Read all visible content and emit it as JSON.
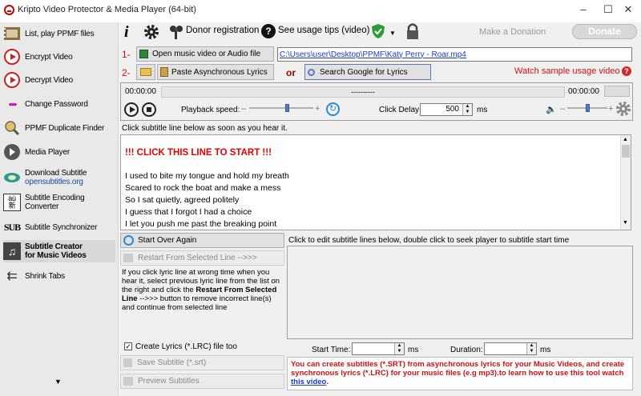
{
  "window": {
    "title": "Kripto Video Protector & Media Player (64-bit)",
    "controls": [
      "–",
      "☐",
      "✕"
    ]
  },
  "sidebar": {
    "items": [
      {
        "label": "List, play PPMF files",
        "icon": "film-list-icon"
      },
      {
        "label": "Encrypt Video",
        "icon": "encrypt-play-icon"
      },
      {
        "label": "Decrypt Video",
        "icon": "decrypt-play-icon"
      },
      {
        "label": "Change Password",
        "icon": "password-dots-icon"
      },
      {
        "label": "PPMF Duplicate Finder",
        "icon": "magnifier-icon"
      },
      {
        "label": "Media Player",
        "icon": "media-player-icon"
      },
      {
        "label": "Download Subtitle",
        "sub": "opensubtitles.org",
        "icon": "opensubtitles-icon"
      },
      {
        "label": "Subtitle Encoding",
        "sub": "Converter",
        "icon": "encoding-icon"
      },
      {
        "label": "Subtitle Synchronizer",
        "icon": "sub-sync-icon"
      },
      {
        "label": "Subtitle Creator",
        "sub": "for Music Videos",
        "icon": "music-subtitle-icon"
      },
      {
        "label": "Shrink Tabs",
        "icon": "shrink-arrows-icon"
      }
    ],
    "more_arrow": "▼"
  },
  "toolbar": {
    "donor_label": "Donor registration",
    "tips_label": "See usage tips (video)",
    "make_donation": "Make a Donation",
    "donate": "Donate"
  },
  "step1": {
    "number": "1-",
    "open_label": "Open music video or Audio file",
    "file_path": "C:\\Users\\user\\Desktop\\PPMF\\Katy Perry - Roar.mp4"
  },
  "step2": {
    "number": "2-",
    "paste_label": "Paste Asynchronous Lyrics",
    "or": "or",
    "search_label": "Search Google for Lyrics",
    "watch_label": "Watch sample usage video"
  },
  "player": {
    "time_start": "00:00:00",
    "time_mid": "----------",
    "time_end": "00:00:00",
    "speed_label": "Playback speed:",
    "minus": "–",
    "plus": "+",
    "delay_label": "Click Delay:",
    "delay_value": "500",
    "delay_unit": "ms",
    "speed_level": 0.6,
    "volume_level": 0.5
  },
  "instruction": "Click subtitle line below as soon as you hear it.",
  "lyrics": [
    "!!! CLICK THIS LINE TO START !!!",
    "I used to bite my tongue and hold my breath",
    "Scared to rock the boat and make a mess",
    "So I sat quietly, agreed politely",
    "I guess that I forgot I had a choice",
    "I let you push me past the breaking point"
  ],
  "controls": {
    "start_over": "Start Over Again",
    "restart_selected": "Restart From Selected Line -->>>",
    "help_text_1": "If you click lyric line at wrong time when you hear it, select previous lyric line from the list on the right and click the ",
    "help_text_bold": "Restart From Selected Line",
    "help_text_2": " -->>> button to remove incorrect line(s) and continue from selected line",
    "edit_hint": "Click to edit subtitle lines below, double click to seek player to subtitle start time",
    "create_lrc": "Create Lyrics (*.LRC) file too",
    "create_lrc_checked": true,
    "save_subtitle": "Save Subtitle (*.srt)",
    "preview": "Preview Subtitles"
  },
  "timing": {
    "start_label": "Start Time:",
    "duration_label": "Duration:",
    "unit": "ms"
  },
  "info": {
    "text": "You can create subtitles (*.SRT) from asynchronous lyrics for your Music Videos, and create synchronous lyrics (*.LRC) for your music files (e.g mp3).to learn how to use this tool watch ",
    "link": "this video",
    "tail": "."
  }
}
